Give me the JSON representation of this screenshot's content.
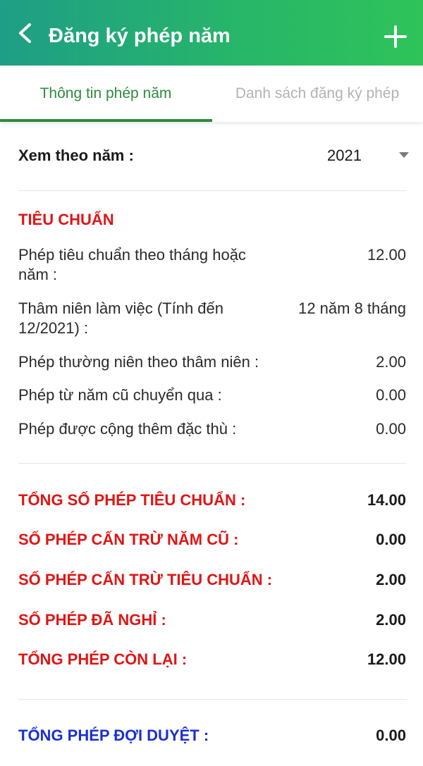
{
  "header": {
    "title": "Đăng ký phép năm",
    "back_icon": "chevron-left-icon",
    "add_icon": "plus-icon",
    "gradient_colors": [
      "#1e9e86",
      "#2fc35a"
    ]
  },
  "tabs": [
    {
      "label": "Thông tin phép năm",
      "active": true
    },
    {
      "label": "Danh sách đăng ký phép",
      "active": false
    }
  ],
  "year_filter": {
    "label": "Xem theo năm :",
    "value": "2021"
  },
  "standard": {
    "section_title": "TIÊU CHUẨN",
    "rows": [
      {
        "label": "Phép tiêu chuẩn theo tháng hoặc năm :",
        "value": "12.00"
      },
      {
        "label": "Thâm niên làm việc  (Tính đến 12/2021) :",
        "value": "12 năm 8 tháng"
      },
      {
        "label": "Phép thường niên theo thâm niên :",
        "value": "2.00"
      },
      {
        "label": "Phép từ năm cũ chuyển qua :",
        "value": "0.00"
      },
      {
        "label": "Phép được cộng thêm đặc thù :",
        "value": "0.00"
      }
    ]
  },
  "totals": [
    {
      "label": "TỔNG SỐ PHÉP TIÊU CHUẨN :",
      "value": "14.00"
    },
    {
      "label": "SỐ PHÉP CẤN TRỪ NĂM CŨ :",
      "value": "0.00"
    },
    {
      "label": "SỐ PHÉP CẤN TRỪ TIÊU CHUẨN :",
      "value": "2.00"
    },
    {
      "label": "SỐ PHÉP ĐÃ NGHỈ :",
      "value": "2.00"
    },
    {
      "label": "TỔNG PHÉP CÒN LẠI :",
      "value": "12.00"
    }
  ],
  "pending": {
    "label": "TỔNG PHÉP ĐỢI DUYỆT :",
    "value": "0.00"
  },
  "colors": {
    "accent_green": "#2e8b3d",
    "red": "#e01515",
    "blue": "#1a2fd6"
  }
}
